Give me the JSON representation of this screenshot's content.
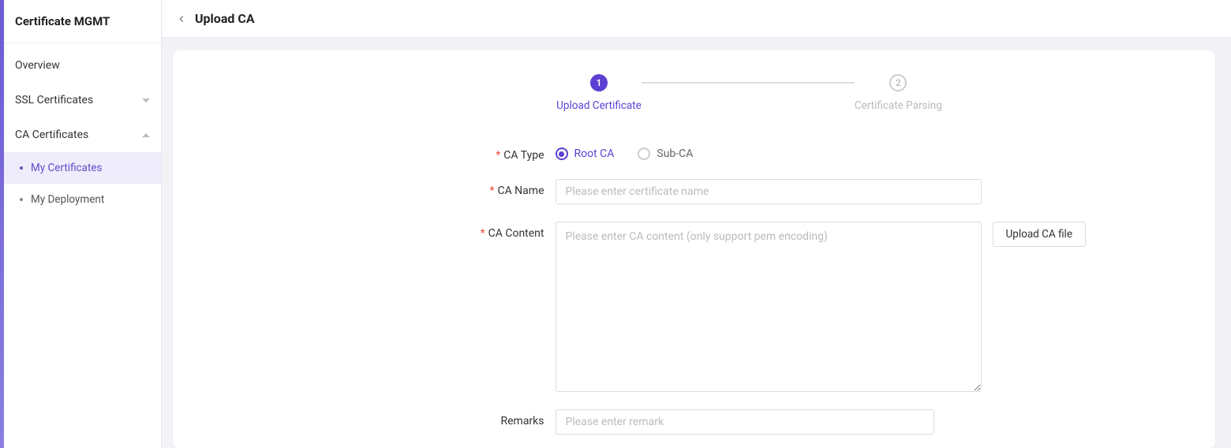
{
  "sidebar": {
    "title": "Certificate MGMT",
    "items": [
      {
        "label": "Overview"
      },
      {
        "label": "SSL Certificates"
      },
      {
        "label": "CA Certificates"
      }
    ],
    "subItems": [
      {
        "label": "My Certificates"
      },
      {
        "label": "My Deployment"
      }
    ]
  },
  "header": {
    "title": "Upload CA"
  },
  "stepper": {
    "step1": {
      "num": "1",
      "label": "Upload Certificate"
    },
    "step2": {
      "num": "2",
      "label": "Certificate Parsing"
    }
  },
  "form": {
    "caType": {
      "label": "CA Type",
      "options": [
        {
          "label": "Root CA"
        },
        {
          "label": "Sub-CA"
        }
      ]
    },
    "caName": {
      "label": "CA Name",
      "placeholder": "Please enter certificate name"
    },
    "caContent": {
      "label": "CA Content",
      "placeholder": "Please enter CA content (only support pem encoding)",
      "uploadBtn": "Upload CA file"
    },
    "remarks": {
      "label": "Remarks",
      "placeholder": "Please enter remark"
    }
  }
}
